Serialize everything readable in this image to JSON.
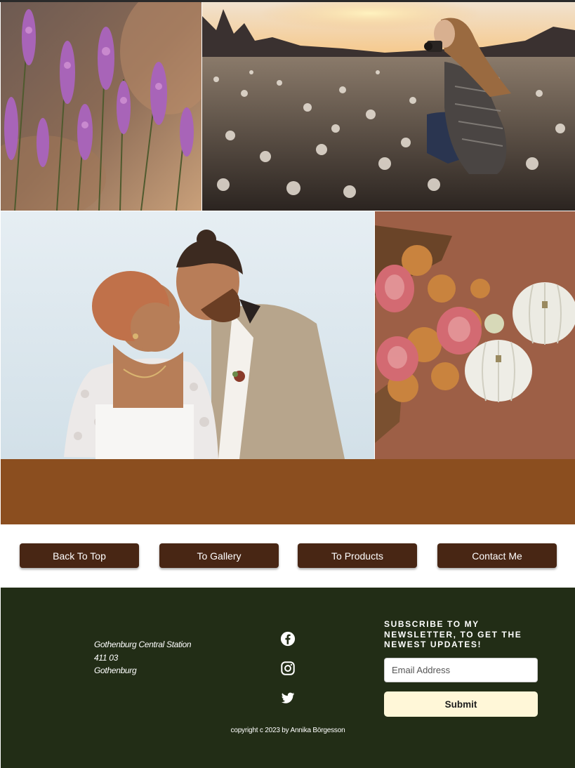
{
  "gallery": {
    "photos": [
      {
        "name": "lavender-photo",
        "description_icon": "lavender-flowers"
      },
      {
        "name": "dandelion-field-photo",
        "description_icon": "photographer-in-field"
      },
      {
        "name": "couple-photo",
        "description_icon": "wedding-couple"
      },
      {
        "name": "pumpkins-photo",
        "description_icon": "pumpkins-and-flowers"
      }
    ]
  },
  "colors": {
    "band": "#8b4e1f",
    "nav_button": "#482614",
    "footer_bg": "#222d16",
    "submit_bg": "#fff7d8"
  },
  "nav": {
    "buttons": [
      {
        "label": "Back To Top"
      },
      {
        "label": "To Gallery"
      },
      {
        "label": "To Products"
      },
      {
        "label": "Contact Me"
      }
    ]
  },
  "footer": {
    "address": {
      "line1": "Gothenburg Central Station",
      "line2": "411 03",
      "line3": "Gothenburg"
    },
    "social": [
      "facebook-icon",
      "instagram-icon",
      "twitter-icon"
    ],
    "newsletter": {
      "title": "Subscribe to my newsletter, to get the newest updates!",
      "placeholder": "Email Address",
      "submit_label": "Submit"
    },
    "copyright": "copyright c 2023 by Annika Börgesson"
  }
}
